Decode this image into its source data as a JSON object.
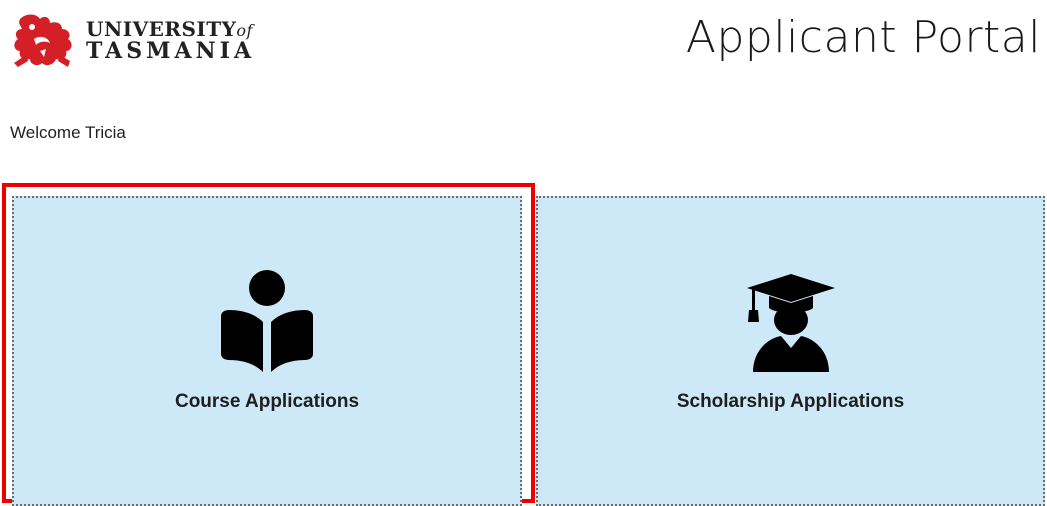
{
  "header": {
    "logo": {
      "line1": "UNIVERSITY",
      "of": "of",
      "line2": "TASMANIA",
      "brand_color": "#d41f26"
    },
    "title": "Applicant Portal"
  },
  "welcome": "Welcome Tricia",
  "tiles": [
    {
      "label": "Course Applications",
      "icon": "reader-book-icon",
      "selected": true
    },
    {
      "label": "Scholarship Applications",
      "icon": "graduate-cap-icon",
      "selected": false
    }
  ],
  "colors": {
    "tile_background": "#cde8f7",
    "highlight_border": "#ee0000"
  }
}
